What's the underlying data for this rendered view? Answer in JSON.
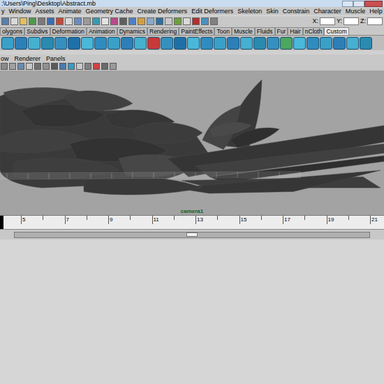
{
  "window": {
    "title": ":\\Users\\Ping\\Desktop\\Abstract.mb"
  },
  "menu": [
    "y",
    "Window",
    "Assets",
    "Animate",
    "Geometry Cache",
    "Create Deformers",
    "Edit Deformers",
    "Skeleton",
    "Skin",
    "Constrain",
    "Character",
    "Muscle",
    "Help"
  ],
  "status_line": {
    "fields": [
      {
        "label": "X:"
      },
      {
        "label": "Y:"
      },
      {
        "label": "Z:"
      }
    ]
  },
  "shelf_tabs": [
    {
      "label": "olygons",
      "selected": false
    },
    {
      "label": "Subdivs",
      "selected": false
    },
    {
      "label": "Deformation",
      "selected": false
    },
    {
      "label": "Animation",
      "selected": false
    },
    {
      "label": "Dynamics",
      "selected": false
    },
    {
      "label": "Rendering",
      "selected": false
    },
    {
      "label": "PaintEffects",
      "selected": false
    },
    {
      "label": "Toon",
      "selected": false
    },
    {
      "label": "Muscle",
      "selected": false
    },
    {
      "label": "Fluids",
      "selected": false
    },
    {
      "label": "Fur",
      "selected": false
    },
    {
      "label": "Hair",
      "selected": false
    },
    {
      "label": "nCloth",
      "selected": false
    },
    {
      "label": "Custom",
      "selected": true
    }
  ],
  "panel_menu": [
    "ow",
    "Renderer",
    "Panels"
  ],
  "viewport": {
    "camera": "camera1"
  },
  "timeline": {
    "labels": [
      "5",
      "7",
      "9",
      "11",
      "13",
      "15",
      "17",
      "19",
      "21"
    ],
    "playhead": {
      "level": 0
    }
  }
}
